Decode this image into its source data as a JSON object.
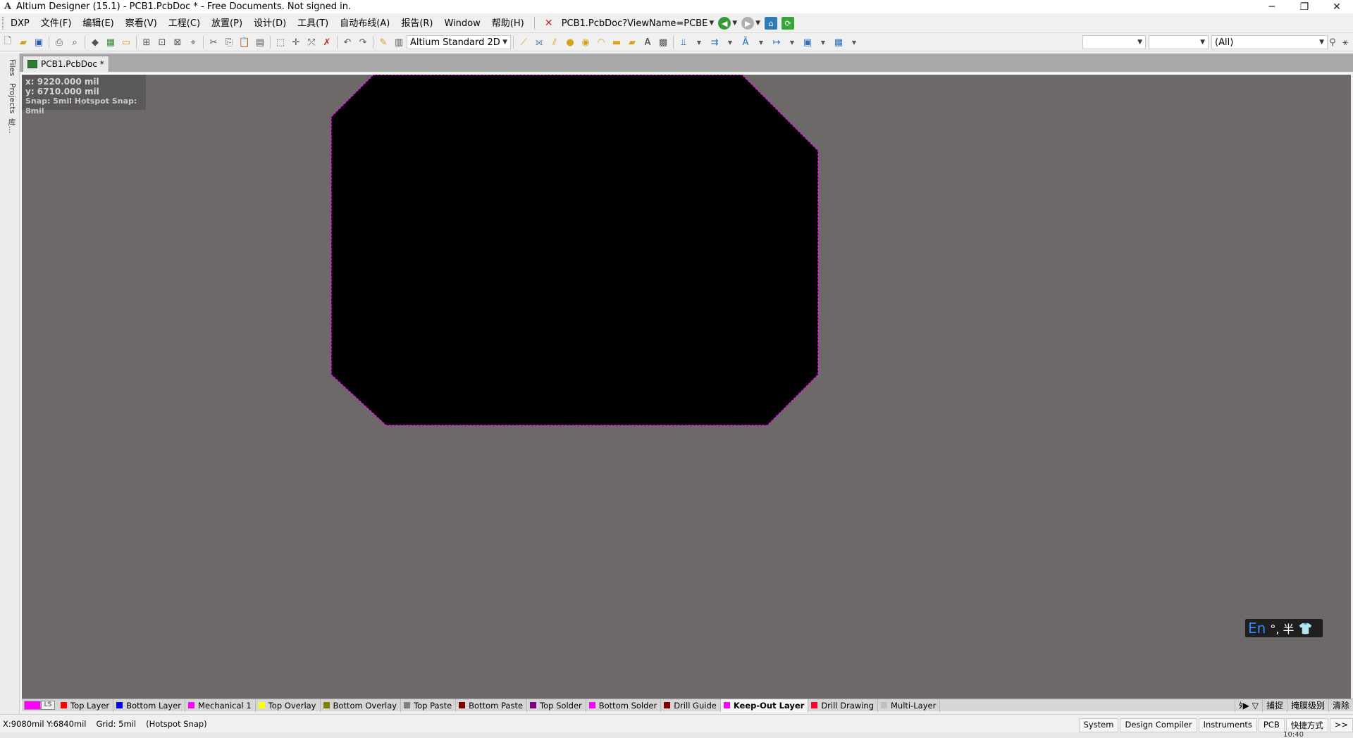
{
  "window": {
    "title": "Altium Designer (15.1) - PCB1.PcbDoc * - Free Documents. Not signed in.",
    "app_icon": "altium-icon",
    "controls": [
      "─",
      "❐",
      "✕"
    ]
  },
  "menu": {
    "items": [
      "DXP",
      "文件(F)",
      "编辑(E)",
      "察看(V)",
      "工程(C)",
      "放置(P)",
      "设计(D)",
      "工具(T)",
      "自动布线(A)",
      "报告(R)",
      "Window",
      "帮助(H)"
    ],
    "address": "PCB1.PcbDoc?ViewName=PCBE"
  },
  "toolbar": {
    "view_mode": "Altium Standard 2D",
    "filter_1": "",
    "filter_2": "",
    "filter_all": "(All)"
  },
  "side_tabs": [
    "Files",
    "Projects",
    "库..."
  ],
  "document": {
    "tab_label": "PCB1.PcbDoc *"
  },
  "hud": {
    "x": "x:  9220.000 mil",
    "y": "y:  6710.000 mil",
    "snap": "Snap: 5mil Hotspot Snap: 8mil"
  },
  "board": {
    "fill": "#000000",
    "outline_color": "#ff00ff",
    "outline_layer": "Keep-Out Layer"
  },
  "ime": {
    "lang": "En",
    "symbols": "°, 半"
  },
  "layers": {
    "ls_label": "LS",
    "current_color": "#ff00ff",
    "tabs": [
      {
        "name": "Top Layer",
        "color": "#ff0000"
      },
      {
        "name": "Bottom Layer",
        "color": "#0000ff"
      },
      {
        "name": "Mechanical 1",
        "color": "#ff00ff"
      },
      {
        "name": "Top Overlay",
        "color": "#ffff00"
      },
      {
        "name": "Bottom Overlay",
        "color": "#808000"
      },
      {
        "name": "Top Paste",
        "color": "#808080"
      },
      {
        "name": "Bottom Paste",
        "color": "#800000"
      },
      {
        "name": "Top Solder",
        "color": "#800080"
      },
      {
        "name": "Bottom Solder",
        "color": "#ff00ff"
      },
      {
        "name": "Drill Guide",
        "color": "#800000"
      },
      {
        "name": "Keep-Out Layer",
        "color": "#ff00ff",
        "active": true
      },
      {
        "name": "Drill Drawing",
        "color": "#ff002a"
      },
      {
        "name": "Multi-Layer",
        "color": "#c0c0c0"
      }
    ],
    "right": [
      "捕捉",
      "掩膜级别",
      "清除"
    ]
  },
  "status": {
    "coords": "X:9080mil Y:6840mil",
    "grid": "Grid: 5mil",
    "snap_mode": "(Hotspot Snap)",
    "panels": [
      "System",
      "Design Compiler",
      "Instruments",
      "PCB",
      "快捷方式",
      ">>"
    ]
  },
  "taskbar": {
    "clock": "10:40"
  }
}
